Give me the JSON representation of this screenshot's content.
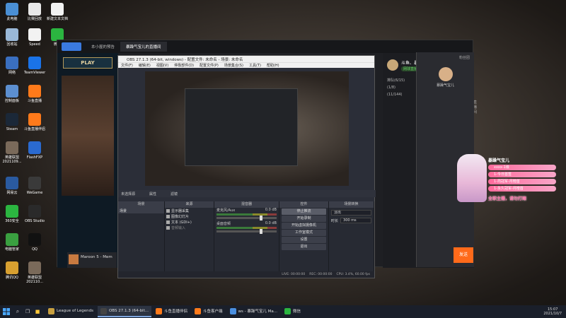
{
  "desktop": {
    "icons": [
      {
        "label": "此电脑",
        "color": "#4a8fd4",
        "icon": "computer-icon"
      },
      {
        "label": "比赛回放",
        "color": "#e8e8e8",
        "icon": "document-icon"
      },
      {
        "label": "新建文本文档",
        "color": "#f2f2f2",
        "icon": "text-file-icon"
      },
      {
        "label": "回收站",
        "color": "#9ab8d8",
        "icon": "recycle-bin-icon"
      },
      {
        "label": "Speed",
        "color": "#f2f2f2",
        "icon": "file-icon"
      },
      {
        "label": "微信",
        "color": "#2bb540",
        "icon": "wechat-icon"
      },
      {
        "label": "网络",
        "color": "#3a6fc0",
        "icon": "network-icon"
      },
      {
        "label": "TeamViewer",
        "color": "#1a73e8",
        "icon": "teamviewer-icon"
      },
      {
        "label": "控制面板",
        "color": "#5c8fd0",
        "icon": "control-panel-icon"
      },
      {
        "label": "斗鱼直播",
        "color": "#ff7a1a",
        "icon": "douyu-icon"
      },
      {
        "label": "Steam",
        "color": "#1b2838",
        "icon": "steam-icon"
      },
      {
        "label": "斗鱼直播伴侣",
        "color": "#ff7a1a",
        "icon": "douyu-companion-icon"
      },
      {
        "label": "英雄联盟 2021109...",
        "color": "#7a6a5a",
        "icon": "image-icon"
      },
      {
        "label": "FlashFXP",
        "color": "#2a6ad0",
        "icon": "flashfxp-icon"
      },
      {
        "label": "网易云",
        "color": "#2a5aa0",
        "icon": "folder-icon"
      },
      {
        "label": "WeGame",
        "color": "#3a3a3a",
        "icon": "wegame-icon"
      },
      {
        "label": "360安全",
        "color": "#2bb540",
        "icon": "security-icon"
      },
      {
        "label": "OBS Studio",
        "color": "#2a2a2a",
        "icon": "obs-icon"
      },
      {
        "label": "电脑管家",
        "color": "#3aa040",
        "icon": "pc-manager-icon"
      },
      {
        "label": "QQ",
        "color": "#111",
        "icon": "qq-icon"
      },
      {
        "label": "腾讯QQ",
        "color": "#d8a030",
        "icon": "apps-icon"
      },
      {
        "label": "英雄联盟 202110...",
        "color": "#7a6a5a",
        "icon": "image-icon"
      }
    ]
  },
  "douyu": {
    "tabs": [
      "本小屋的预告",
      "暴躁气宝儿的直播间"
    ],
    "play_label": "PLAY",
    "music_title": "Maroon 5 - Mem",
    "streamer_name": "斗鱼、暴躁气宝儿",
    "streamer_tag": "网球直播",
    "queue": [
      "排队(6/15)",
      "(1/8)",
      "(11/144)"
    ],
    "room_link": "直播间",
    "send_label": "发送",
    "gift_title": "暴躁气宝儿",
    "badges": [
      "xxxx-1级",
      "1-今日首签",
      "1-周冠军-月榜首",
      "1-永久冠军-月榜首"
    ],
    "slogan": "全职主播，请勿打赌",
    "top_right": "粉丝团"
  },
  "obs": {
    "title": "OBS 27.1.3 (64-bit, windows) - 配置文件: 未命名 - 场景: 未命名",
    "menu": [
      "文件(F)",
      "编辑(E)",
      "视图(V)",
      "停靠部件(D)",
      "配置文件(P)",
      "场景集合(S)",
      "工具(T)",
      "帮助(H)"
    ],
    "no_source_label": "未选择源",
    "properties_label": "属性",
    "filters_label": "滤镜",
    "docks": {
      "scenes": "场景",
      "sources": "来源",
      "mixer": "混音器",
      "transitions": "场景转换",
      "controls": "控件"
    },
    "scene_items": [
      "场景"
    ],
    "source_items": [
      "显示器采集",
      "图像幻灯片",
      "文本 (GDI+)",
      "音频输入"
    ],
    "mixer_rows": [
      {
        "name": "麦克风/Aux",
        "db": "0.0 dB"
      },
      {
        "name": "桌面音频",
        "db": "0.0 dB"
      }
    ],
    "control_buttons": [
      "停止推流",
      "开始录制",
      "开始虚拟摄像机",
      "工作室模式",
      "设置",
      "退出"
    ],
    "transition": {
      "type": "淡出",
      "duration_label": "时长",
      "duration": "300 ms"
    },
    "status": [
      "LIVE: 00:00:00",
      "REC: 00:00:00",
      "CPU: 3.4%, 60.00 fps"
    ]
  },
  "taskbar": {
    "items": [
      {
        "label": "League of Legends",
        "color": "#c8a040"
      },
      {
        "label": "OBS 27.1.3 (64-bit...",
        "color": "#444"
      },
      {
        "label": "斗鱼直播伴侣",
        "color": "#ff7a1a"
      },
      {
        "label": "斗鱼客户端",
        "color": "#ff7a1a"
      },
      {
        "label": "ws - 暴躁气宝儿 Ma...",
        "color": "#4a8fe0"
      },
      {
        "label": "微信",
        "color": "#2bb540"
      }
    ],
    "time": "15:07",
    "date": "2021/10/7"
  }
}
